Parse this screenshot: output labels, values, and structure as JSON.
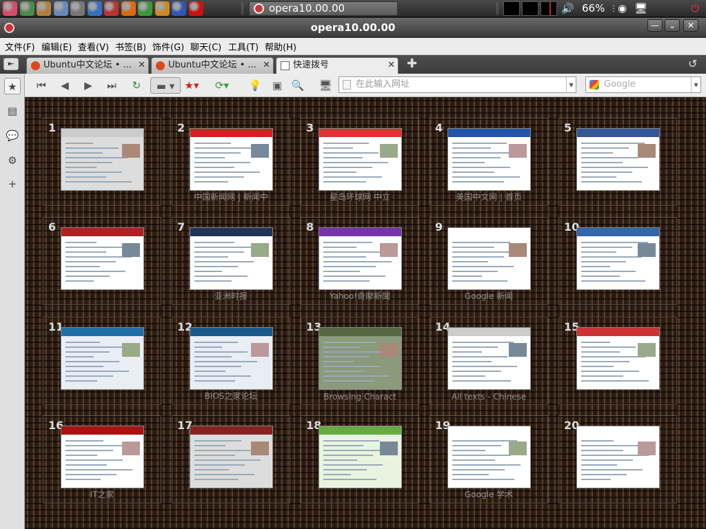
{
  "panel": {
    "launchers": [
      {
        "icon": "star-menu-icon",
        "color": "#d94b6b"
      },
      {
        "icon": "terminal-icon",
        "color": "#4a8a4a"
      },
      {
        "icon": "gimp-icon",
        "color": "#b08040"
      },
      {
        "icon": "pictures-icon",
        "color": "#6688bb"
      },
      {
        "icon": "drive-icon",
        "color": "#777777"
      },
      {
        "icon": "browser-icon",
        "color": "#3a70c0"
      },
      {
        "icon": "magnifier-icon",
        "color": "#bb3333"
      },
      {
        "icon": "update-icon",
        "color": "#dd6a10"
      },
      {
        "icon": "plant-icon",
        "color": "#3a9a3a"
      },
      {
        "icon": "toolbox-icon",
        "color": "#cc8822"
      },
      {
        "icon": "network-icon",
        "color": "#3355bb"
      },
      {
        "icon": "opera-icon",
        "color": "#cc1111"
      }
    ],
    "task_title": "opera10.00.00",
    "volume_percent": "66%"
  },
  "window": {
    "title": "opera10.00.00"
  },
  "menu": [
    "文件(F)",
    "编辑(E)",
    "查看(V)",
    "书签(B)",
    "饰件(G)",
    "聊天(C)",
    "工具(T)",
    "帮助(H)"
  ],
  "tabs": [
    {
      "label": "Ubuntu中文论坛 • ..."
    },
    {
      "label": "Ubuntu中文论坛 • ..."
    },
    {
      "label": "快速拨号"
    }
  ],
  "address": {
    "placeholder": "在此输入网址"
  },
  "search": {
    "placeholder": "Google"
  },
  "speed_dial": [
    {
      "num": "1",
      "caption": "",
      "color": "#ddd",
      "hdr": "#ccc"
    },
    {
      "num": "2",
      "caption": "中国新闻网 | 新闻中",
      "color": "#fff",
      "hdr": "#c22"
    },
    {
      "num": "3",
      "caption": "星岛环球网 中立",
      "color": "#fff",
      "hdr": "#d33"
    },
    {
      "num": "4",
      "caption": "美国中文网 | 首页",
      "color": "#fff",
      "hdr": "#2255aa"
    },
    {
      "num": "5",
      "caption": "",
      "color": "#fff",
      "hdr": "#335599"
    },
    {
      "num": "6",
      "caption": "",
      "color": "#fff",
      "hdr": "#aa2222"
    },
    {
      "num": "7",
      "caption": "亚洲时报",
      "color": "#fff",
      "hdr": "#223355"
    },
    {
      "num": "8",
      "caption": "Yahoo!奇摩新聞",
      "color": "#fff",
      "hdr": "#7733aa"
    },
    {
      "num": "9",
      "caption": "Google 新闻",
      "color": "#fff",
      "hdr": "#fff"
    },
    {
      "num": "10",
      "caption": "",
      "color": "#fff",
      "hdr": "#3366aa"
    },
    {
      "num": "11",
      "caption": "",
      "color": "#e8eef4",
      "hdr": "#1e6fa6"
    },
    {
      "num": "12",
      "caption": "BIOS之家论坛",
      "color": "#e8eef4",
      "hdr": "#1a5a8a"
    },
    {
      "num": "13",
      "caption": "Browsing Charact",
      "color": "#8a9a7a",
      "hdr": "#556644"
    },
    {
      "num": "14",
      "caption": "All texts - Chinese",
      "color": "#fff",
      "hdr": "#ccc"
    },
    {
      "num": "15",
      "caption": "",
      "color": "#fff",
      "hdr": "#cc3333"
    },
    {
      "num": "16",
      "caption": "IT之家",
      "color": "#fff",
      "hdr": "#aa1111"
    },
    {
      "num": "17",
      "caption": "",
      "color": "#ddd",
      "hdr": "#882222"
    },
    {
      "num": "18",
      "caption": "",
      "color": "#e8f4e0",
      "hdr": "#66aa44"
    },
    {
      "num": "19",
      "caption": "Google 学术",
      "color": "#fff",
      "hdr": "#fff"
    },
    {
      "num": "20",
      "caption": "",
      "color": "#fff",
      "hdr": "#fff"
    }
  ]
}
